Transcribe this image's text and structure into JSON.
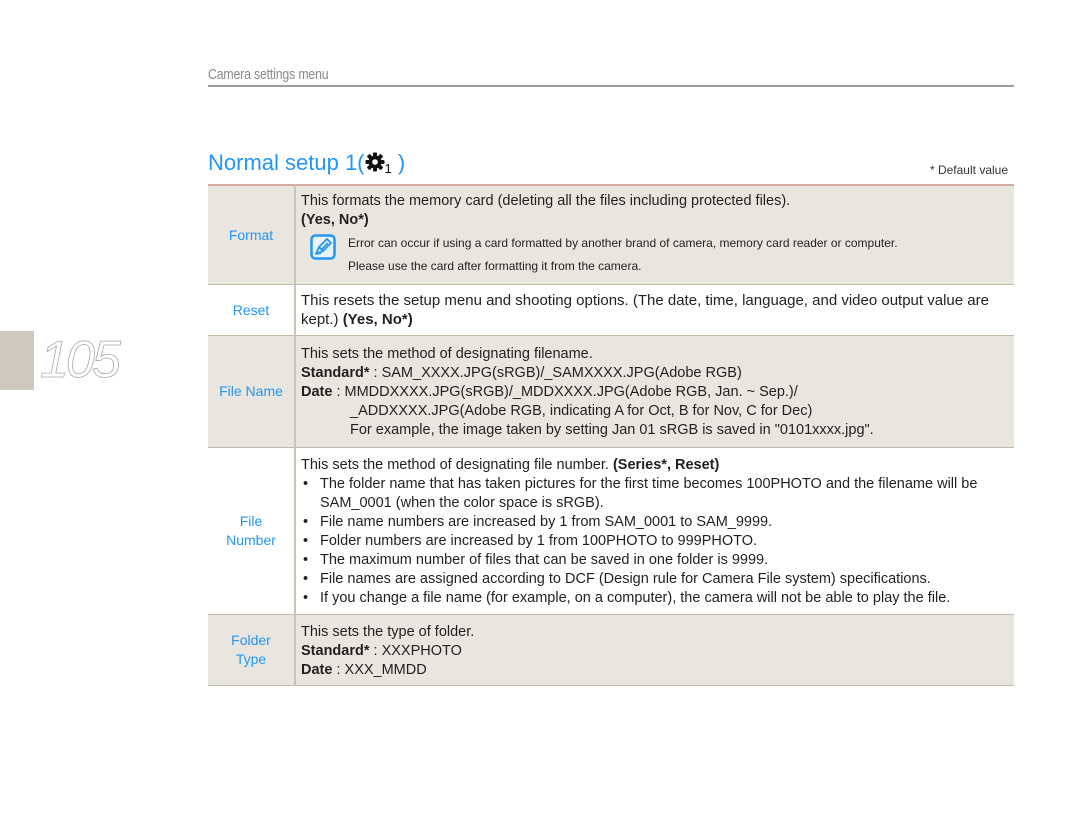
{
  "header": {
    "title": "Camera settings menu"
  },
  "page_number": "105",
  "section": {
    "title": "Normal setup 1(",
    "icon_subscript": "1",
    "title_end": " )"
  },
  "default_note": "* Default value",
  "rows": {
    "format": {
      "label": "Format",
      "line1": "This formats the memory card (deleting all the files including protected files).",
      "options": "(Yes, No*)",
      "note_line1": "Error can occur if using a card formatted by another brand of camera, memory card reader or computer.",
      "note_line2": "Please use the card after formatting it from the camera."
    },
    "reset": {
      "label": "Reset",
      "text": "This resets the setup menu and shooting options. (The date, time, language, and video output value are kept.) ",
      "options": "(Yes, No*)"
    },
    "file_name": {
      "label": "File Name",
      "line1": "This sets the method of designating filename.",
      "standard_label": "Standard*",
      "standard_value": " : SAM_XXXX.JPG(sRGB)/_SAMXXXX.JPG(Adobe RGB)",
      "date_label": "Date",
      "date_value": " : MMDDXXXX.JPG(sRGB)/_MDDXXXX.JPG(Adobe RGB, Jan. ~ Sep.)/",
      "date_cont": "_ADDXXXX.JPG(Adobe RGB,  indicating A for Oct, B for Nov, C for Dec)",
      "example": "For example, the image taken by setting Jan 01 sRGB is saved in \"0101xxxx.jpg\"."
    },
    "file_number": {
      "label_line1": "File",
      "label_line2": "Number",
      "line1": "This sets the method of designating file number. ",
      "options": "(Series*, Reset)",
      "bullets": [
        "The folder name that has taken pictures for the first time becomes 100PHOTO and the filename will be SAM_0001 (when the color space is sRGB).",
        "File name numbers are increased by 1 from SAM_0001 to SAM_9999.",
        "Folder numbers are increased by 1 from 100PHOTO to 999PHOTO.",
        "The maximum number of files that can be saved in one folder is 9999.",
        "File names are assigned according to DCF (Design rule for Camera File system) specifications.",
        "If you change a file name (for example, on a computer), the camera will not be able to play the file."
      ]
    },
    "folder_type": {
      "label_line1": "Folder",
      "label_line2": "Type",
      "line1": "This sets the type of folder.",
      "standard_label": "Standard*",
      "standard_value": " : XXXPHOTO",
      "date_label": "Date",
      "date_value": " : XXX_MMDD"
    }
  },
  "colors": {
    "accent": "#2196f3",
    "row_shade": "#e9e5df",
    "page_tab": "#cfc8bc"
  }
}
